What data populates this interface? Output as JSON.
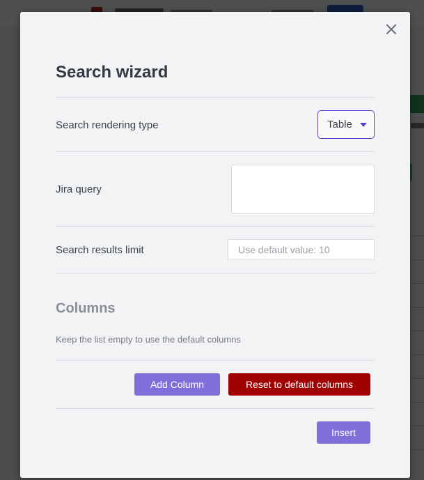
{
  "dialog": {
    "title": "Search wizard",
    "close_icon": "close-icon"
  },
  "fields": {
    "rendering_type": {
      "label": "Search rendering type",
      "value": "Table"
    },
    "jira_query": {
      "label": "Jira query",
      "value": ""
    },
    "results_limit": {
      "label": "Search results limit",
      "placeholder": "Use default value: 10",
      "value": ""
    }
  },
  "columns": {
    "title": "Columns",
    "description": "Keep the list empty to use the default columns",
    "add_label": "Add Column",
    "reset_label": "Reset to default columns"
  },
  "footer": {
    "insert_label": "Insert"
  },
  "colors": {
    "accent": "#5b3fd1",
    "button_primary": "#7f6fdb",
    "button_danger": "#a00000"
  }
}
